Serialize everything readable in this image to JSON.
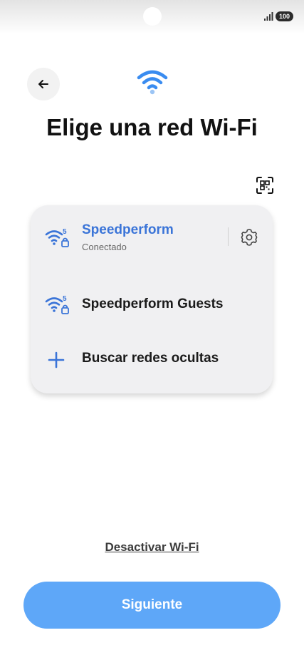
{
  "status_bar": {
    "battery_level": "100",
    "signal_icon": "signal-bars-icon"
  },
  "header": {
    "back_icon": "arrow-left-icon",
    "wifi_icon": "wifi-icon",
    "title": "Elige una red Wi-Fi",
    "qr_icon": "qr-code-scan-icon"
  },
  "networks": [
    {
      "name": "Speedperform",
      "status": "Conectado",
      "band": "5",
      "connected": true,
      "icon": "wifi-5ghz-lock-icon",
      "settings_icon": "gear-icon"
    },
    {
      "name": "Speedperform Guests",
      "band": "5",
      "connected": false,
      "icon": "wifi-5ghz-lock-icon"
    }
  ],
  "hidden_networks": {
    "label": "Buscar redes ocultas",
    "icon": "plus-icon"
  },
  "footer": {
    "disable_wifi_label": "Desactivar Wi-Fi",
    "next_label": "Siguiente"
  },
  "colors": {
    "accent": "#3a74d8",
    "button": "#5ea7f8",
    "card": "#f0f0f2"
  }
}
